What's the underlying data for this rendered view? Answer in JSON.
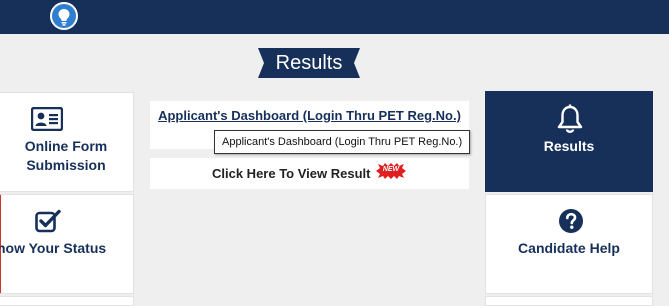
{
  "header": {
    "logo_icon": "lightbulb-icon",
    "color": "#17305a"
  },
  "section": {
    "title": "Results"
  },
  "left_tiles": [
    {
      "label_line1": "Online Form",
      "label_line2": "Submission",
      "icon": "id-card-icon"
    },
    {
      "label": "how Your Status",
      "icon": "checkbox-icon"
    }
  ],
  "right_tiles": [
    {
      "label": "Results",
      "icon": "bell-icon",
      "active": true
    },
    {
      "label": "Candidate Help",
      "icon": "question-circle-icon"
    }
  ],
  "links": {
    "dashboard": "Applicant's Dashboard (Login Thru PET Reg.No.)",
    "view_result": "Click Here To View Result",
    "new_badge": "NEW"
  },
  "tooltip": {
    "text": "Applicant's Dashboard (Login Thru PET Reg.No.)"
  },
  "colors": {
    "primary": "#17305a",
    "badge_red": "#e02020",
    "accent_red": "#c0392b"
  }
}
